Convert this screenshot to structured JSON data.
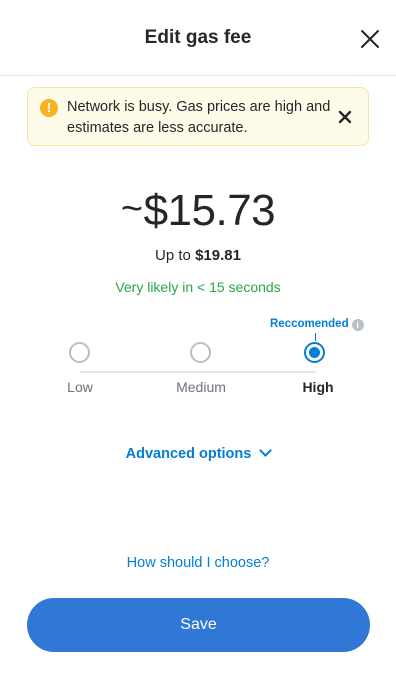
{
  "header": {
    "title": "Edit gas fee",
    "close_icon": "close-icon"
  },
  "warning": {
    "icon": "exclamation-circle-icon",
    "text": "Network is busy. Gas prices are high and estimates are less accurate.",
    "close_icon": "close-icon"
  },
  "fee": {
    "tilde": "~",
    "estimate": "$15.73",
    "max_prefix": "Up to",
    "max_value": "$19.81",
    "timing": "Very likely in < 15 seconds"
  },
  "options": {
    "recommended_label": "Reccomended",
    "recommended_info_icon": "info-icon",
    "items": [
      {
        "label": "Low",
        "selected": false
      },
      {
        "label": "Medium",
        "selected": false
      },
      {
        "label": "High",
        "selected": true
      }
    ]
  },
  "advanced": {
    "label": "Advanced options",
    "icon": "chevron-down-icon"
  },
  "help": {
    "label": "How should I choose?"
  },
  "footer": {
    "save_label": "Save"
  },
  "colors": {
    "accent": "#037dd6",
    "save_button": "#3077d6",
    "success": "#28a745",
    "warning_bg": "#fefbe8",
    "warning_icon": "#f6b425"
  }
}
